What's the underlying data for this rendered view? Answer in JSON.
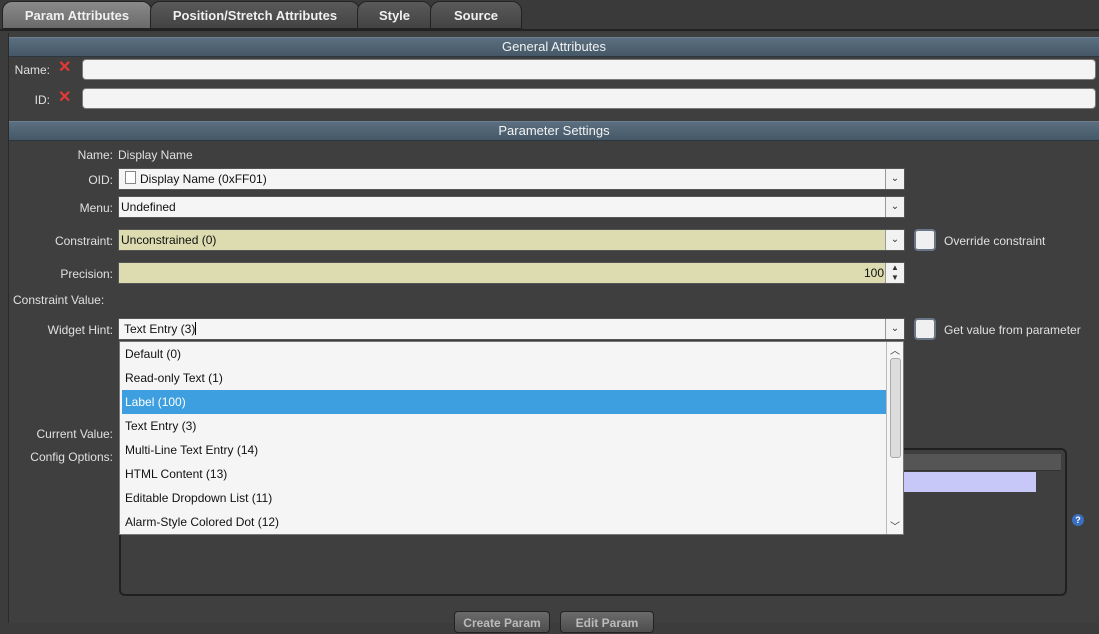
{
  "tabs": [
    {
      "label": "Param Attributes"
    },
    {
      "label": "Position/Stretch Attributes"
    },
    {
      "label": "Style"
    },
    {
      "label": "Source"
    }
  ],
  "general": {
    "header": "General Attributes",
    "name_label": "Name:",
    "id_label": "ID:"
  },
  "param": {
    "header": "Parameter Settings",
    "name_label": "Name:",
    "name_value": "Display Name",
    "oid_label": "OID:",
    "oid_value": "Display Name (0xFF01)",
    "menu_label": "Menu:",
    "menu_value": "Undefined",
    "constraint_label": "Constraint:",
    "constraint_value": "Unconstrained (0)",
    "override_label": "Override constraint",
    "precision_label": "Precision:",
    "precision_value": "100",
    "constraint_value_label": "Constraint Value:",
    "widget_hint_label": "Widget Hint:",
    "widget_hint_value": "Text Entry (3)",
    "get_value_label": "Get value from parameter",
    "current_value_label": "Current Value:",
    "config_options_label": "Config Options:"
  },
  "dropdown": {
    "items": [
      "Default (0)",
      "Read-only Text (1)",
      "Label (100)",
      "Text Entry (3)",
      "Multi-Line Text Entry (14)",
      "HTML Content (13)",
      "Editable Dropdown List (11)",
      "Alarm-Style Colored Dot (12)"
    ],
    "selected_index": 2
  },
  "buttons": {
    "create": "Create Param",
    "edit": "Edit Param"
  },
  "colors": {
    "accent_selection": "#3d9fe0",
    "section_header": "#4d6172",
    "constraint_bg": "#dcdcb0"
  }
}
